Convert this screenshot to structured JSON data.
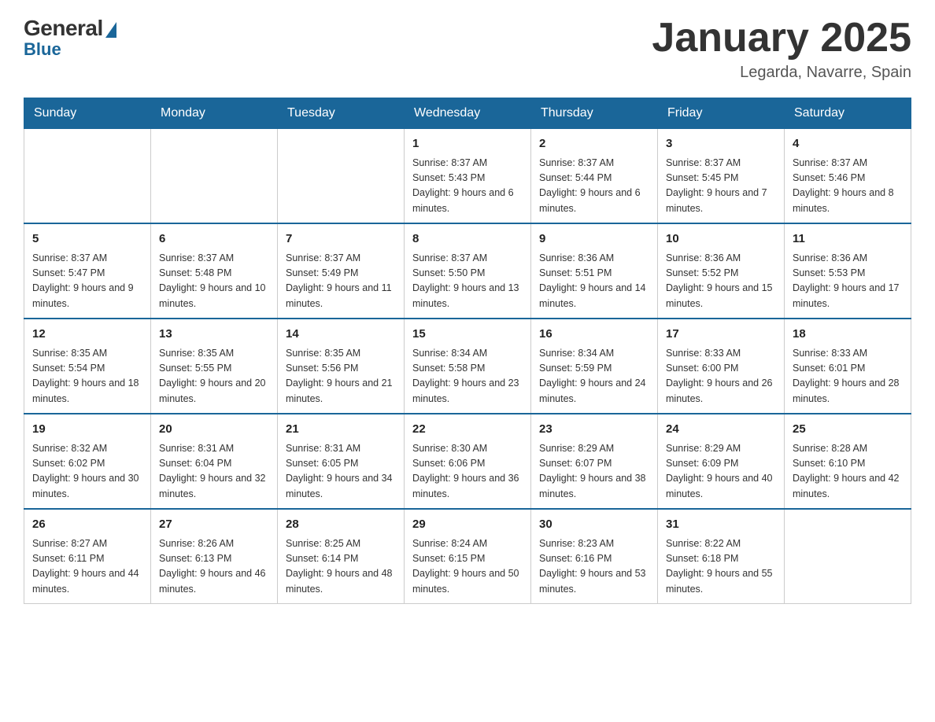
{
  "header": {
    "logo": {
      "general": "General",
      "blue": "Blue"
    },
    "title": "January 2025",
    "location": "Legarda, Navarre, Spain"
  },
  "days": [
    "Sunday",
    "Monday",
    "Tuesday",
    "Wednesday",
    "Thursday",
    "Friday",
    "Saturday"
  ],
  "weeks": [
    [
      {
        "day": "",
        "info": ""
      },
      {
        "day": "",
        "info": ""
      },
      {
        "day": "",
        "info": ""
      },
      {
        "day": "1",
        "info": "Sunrise: 8:37 AM\nSunset: 5:43 PM\nDaylight: 9 hours and 6 minutes."
      },
      {
        "day": "2",
        "info": "Sunrise: 8:37 AM\nSunset: 5:44 PM\nDaylight: 9 hours and 6 minutes."
      },
      {
        "day": "3",
        "info": "Sunrise: 8:37 AM\nSunset: 5:45 PM\nDaylight: 9 hours and 7 minutes."
      },
      {
        "day": "4",
        "info": "Sunrise: 8:37 AM\nSunset: 5:46 PM\nDaylight: 9 hours and 8 minutes."
      }
    ],
    [
      {
        "day": "5",
        "info": "Sunrise: 8:37 AM\nSunset: 5:47 PM\nDaylight: 9 hours and 9 minutes."
      },
      {
        "day": "6",
        "info": "Sunrise: 8:37 AM\nSunset: 5:48 PM\nDaylight: 9 hours and 10 minutes."
      },
      {
        "day": "7",
        "info": "Sunrise: 8:37 AM\nSunset: 5:49 PM\nDaylight: 9 hours and 11 minutes."
      },
      {
        "day": "8",
        "info": "Sunrise: 8:37 AM\nSunset: 5:50 PM\nDaylight: 9 hours and 13 minutes."
      },
      {
        "day": "9",
        "info": "Sunrise: 8:36 AM\nSunset: 5:51 PM\nDaylight: 9 hours and 14 minutes."
      },
      {
        "day": "10",
        "info": "Sunrise: 8:36 AM\nSunset: 5:52 PM\nDaylight: 9 hours and 15 minutes."
      },
      {
        "day": "11",
        "info": "Sunrise: 8:36 AM\nSunset: 5:53 PM\nDaylight: 9 hours and 17 minutes."
      }
    ],
    [
      {
        "day": "12",
        "info": "Sunrise: 8:35 AM\nSunset: 5:54 PM\nDaylight: 9 hours and 18 minutes."
      },
      {
        "day": "13",
        "info": "Sunrise: 8:35 AM\nSunset: 5:55 PM\nDaylight: 9 hours and 20 minutes."
      },
      {
        "day": "14",
        "info": "Sunrise: 8:35 AM\nSunset: 5:56 PM\nDaylight: 9 hours and 21 minutes."
      },
      {
        "day": "15",
        "info": "Sunrise: 8:34 AM\nSunset: 5:58 PM\nDaylight: 9 hours and 23 minutes."
      },
      {
        "day": "16",
        "info": "Sunrise: 8:34 AM\nSunset: 5:59 PM\nDaylight: 9 hours and 24 minutes."
      },
      {
        "day": "17",
        "info": "Sunrise: 8:33 AM\nSunset: 6:00 PM\nDaylight: 9 hours and 26 minutes."
      },
      {
        "day": "18",
        "info": "Sunrise: 8:33 AM\nSunset: 6:01 PM\nDaylight: 9 hours and 28 minutes."
      }
    ],
    [
      {
        "day": "19",
        "info": "Sunrise: 8:32 AM\nSunset: 6:02 PM\nDaylight: 9 hours and 30 minutes."
      },
      {
        "day": "20",
        "info": "Sunrise: 8:31 AM\nSunset: 6:04 PM\nDaylight: 9 hours and 32 minutes."
      },
      {
        "day": "21",
        "info": "Sunrise: 8:31 AM\nSunset: 6:05 PM\nDaylight: 9 hours and 34 minutes."
      },
      {
        "day": "22",
        "info": "Sunrise: 8:30 AM\nSunset: 6:06 PM\nDaylight: 9 hours and 36 minutes."
      },
      {
        "day": "23",
        "info": "Sunrise: 8:29 AM\nSunset: 6:07 PM\nDaylight: 9 hours and 38 minutes."
      },
      {
        "day": "24",
        "info": "Sunrise: 8:29 AM\nSunset: 6:09 PM\nDaylight: 9 hours and 40 minutes."
      },
      {
        "day": "25",
        "info": "Sunrise: 8:28 AM\nSunset: 6:10 PM\nDaylight: 9 hours and 42 minutes."
      }
    ],
    [
      {
        "day": "26",
        "info": "Sunrise: 8:27 AM\nSunset: 6:11 PM\nDaylight: 9 hours and 44 minutes."
      },
      {
        "day": "27",
        "info": "Sunrise: 8:26 AM\nSunset: 6:13 PM\nDaylight: 9 hours and 46 minutes."
      },
      {
        "day": "28",
        "info": "Sunrise: 8:25 AM\nSunset: 6:14 PM\nDaylight: 9 hours and 48 minutes."
      },
      {
        "day": "29",
        "info": "Sunrise: 8:24 AM\nSunset: 6:15 PM\nDaylight: 9 hours and 50 minutes."
      },
      {
        "day": "30",
        "info": "Sunrise: 8:23 AM\nSunset: 6:16 PM\nDaylight: 9 hours and 53 minutes."
      },
      {
        "day": "31",
        "info": "Sunrise: 8:22 AM\nSunset: 6:18 PM\nDaylight: 9 hours and 55 minutes."
      },
      {
        "day": "",
        "info": ""
      }
    ]
  ]
}
